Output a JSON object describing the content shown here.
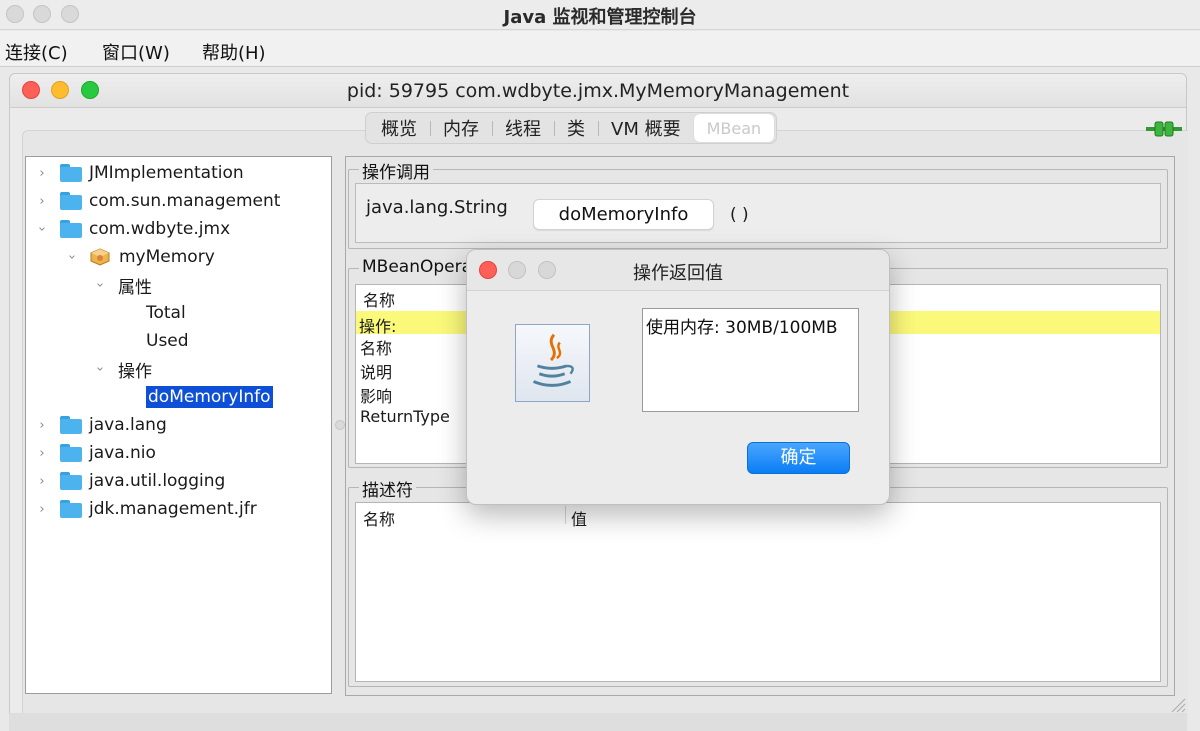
{
  "app": {
    "title": "Java 监视和管理控制台"
  },
  "menu": [
    "连接(C)",
    "窗口(W)",
    "帮助(H)"
  ],
  "frame": {
    "title": "pid: 59795 com.wdbyte.jmx.MyMemoryManagement"
  },
  "tabs": [
    {
      "label": "概览",
      "active": false
    },
    {
      "label": "内存",
      "active": false
    },
    {
      "label": "线程",
      "active": false
    },
    {
      "label": "类",
      "active": false
    },
    {
      "label": "VM 概要",
      "active": false
    },
    {
      "label": "MBean",
      "active": true
    }
  ],
  "tree": {
    "n1": "JMImplementation",
    "n2": "com.sun.management",
    "n3": "com.wdbyte.jmx",
    "n4": "myMemory",
    "n5": "属性",
    "n6": "Total",
    "n7": "Used",
    "n8": "操作",
    "n9": "doMemoryInfo",
    "n10": "java.lang",
    "n11": "java.nio",
    "n12": "java.util.logging",
    "n13": "jdk.management.jfr"
  },
  "invoke": {
    "group_title": "操作调用",
    "return_type": "java.lang.String",
    "button": "doMemoryInfo",
    "parens": "( )"
  },
  "opinfo": {
    "group_title": "MBeanOpera",
    "header": "名称",
    "rows": [
      "操作:",
      "名称",
      "说明",
      "影响",
      "ReturnType"
    ]
  },
  "descriptor": {
    "group_title": "描述符",
    "col_name": "名称",
    "col_value": "值"
  },
  "dialog": {
    "title": "操作返回值",
    "result": "使用内存: 30MB/100MB",
    "ok": "确定"
  },
  "colors": {
    "selection": "#0d4fd6",
    "highlight_row": "#fbf97a",
    "ok_button": "#0a7df5"
  }
}
